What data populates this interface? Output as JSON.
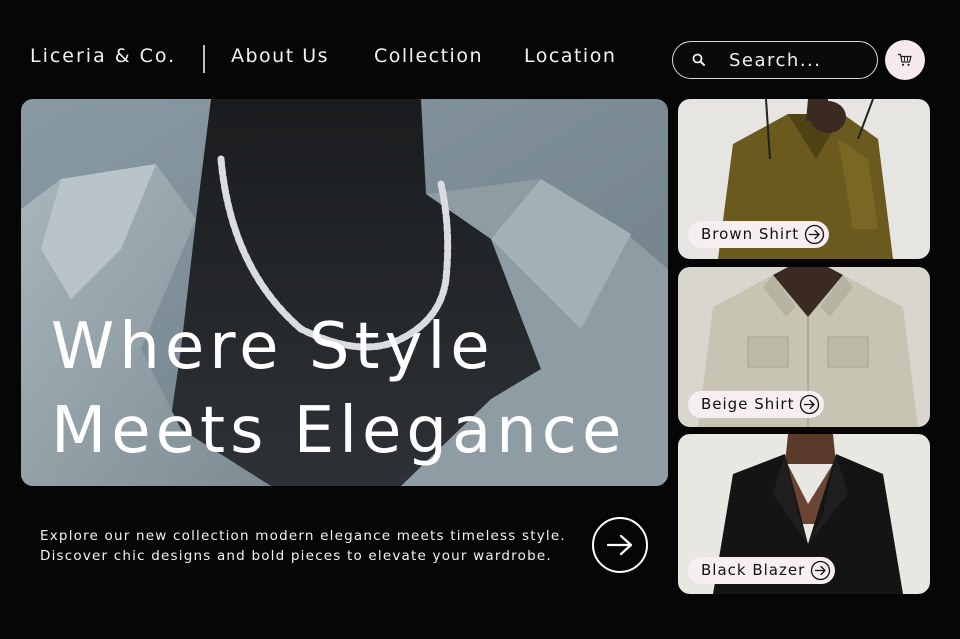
{
  "header": {
    "brand": "Liceria & Co.",
    "nav": [
      "About Us",
      "Collection",
      "Location"
    ],
    "search_placeholder": "Search...",
    "cart_icon": "cart-icon"
  },
  "hero": {
    "title_line1": "Where Style",
    "title_line2": "Meets Elegance",
    "tagline_line1": "Explore our new collection modern elegance meets timeless style.",
    "tagline_line2": "Discover chic designs and bold pieces to elevate your wardrobe.",
    "cta_icon": "arrow-right-icon"
  },
  "products": [
    {
      "label": "Brown Shirt"
    },
    {
      "label": "Beige Shirt"
    },
    {
      "label": "Black Blazer"
    }
  ],
  "colors": {
    "background": "#060606",
    "text": "#ffffff",
    "pill": "#f6eef2",
    "cart_button": "#f6e9ef"
  }
}
